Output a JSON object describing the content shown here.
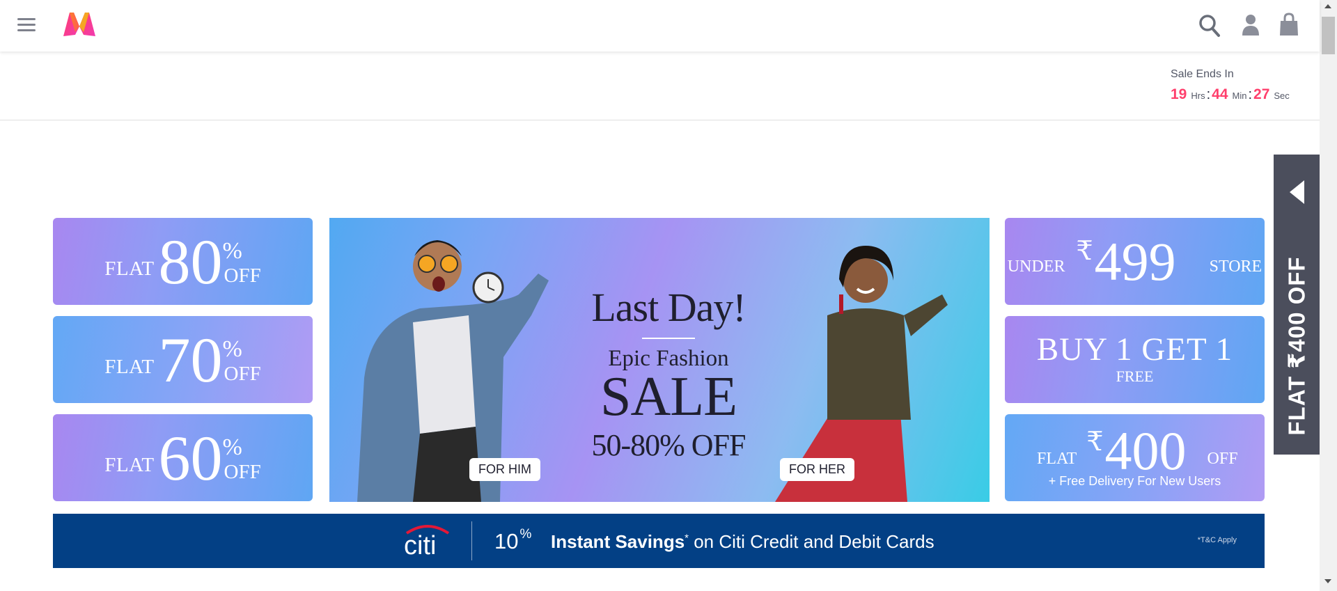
{
  "header": {
    "menu_icon": "hamburger-menu-icon",
    "logo_icon": "myntra-logo-icon",
    "search_icon": "search-icon",
    "profile_icon": "user-profile-icon",
    "bag_icon": "shopping-bag-icon"
  },
  "timer": {
    "title": "Sale Ends In",
    "hours": "19",
    "hours_unit": "Hrs",
    "minutes": "44",
    "minutes_unit": "Min",
    "seconds": "27",
    "seconds_unit": "Sec",
    "colon": ":",
    "number_color": "#ff3f6c"
  },
  "left_tiles": [
    {
      "flat": "FLAT",
      "value": "80",
      "pct": "%",
      "off": "OFF"
    },
    {
      "flat": "FLAT",
      "value": "70",
      "pct": "%",
      "off": "OFF"
    },
    {
      "flat": "FLAT",
      "value": "60",
      "pct": "%",
      "off": "OFF"
    }
  ],
  "hero": {
    "line1": "Last Day!",
    "line2": "Epic Fashion",
    "line3": "SALE",
    "line4": "50-80% OFF",
    "btn_him": "FOR HIM",
    "btn_her": "FOR HER"
  },
  "right_tiles": {
    "under": {
      "prefix": "UNDER",
      "rupee": "₹",
      "value": "499",
      "suffix": "STORE"
    },
    "bogo": {
      "line1": "BUY 1 GET 1",
      "line2": "FREE"
    },
    "flat400": {
      "flat": "FLAT",
      "rupee": "₹",
      "value": "400",
      "off": "OFF",
      "sub": "+ Free Delivery For New Users"
    }
  },
  "side_flag": {
    "text": "FLAT ₹400 OFF",
    "arrow_icon": "caret-left-icon"
  },
  "citi": {
    "logo": "citi",
    "pct": "10",
    "pct_sign": "%",
    "bold_text": "Instant Savings",
    "star": "*",
    "rest_text": " on Citi Credit and Debit Cards",
    "tc": "*T&C Apply",
    "background": "#034085"
  },
  "colors": {
    "accent": "#ff3f6c",
    "side_flag": "#4b4e5c"
  }
}
